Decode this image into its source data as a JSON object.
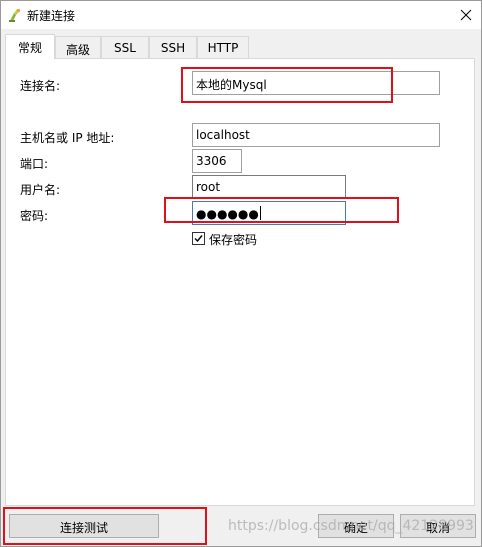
{
  "window": {
    "title": "新建连接",
    "app_icon": "navicat-connection-icon",
    "close_symbol": "✕"
  },
  "tabs": [
    {
      "label": "常规",
      "active": true
    },
    {
      "label": "高级",
      "active": false
    },
    {
      "label": "SSL",
      "active": false
    },
    {
      "label": "SSH",
      "active": false
    },
    {
      "label": "HTTP",
      "active": false
    }
  ],
  "form": {
    "connection_name": {
      "label": "连接名:",
      "value": "本地的Mysql"
    },
    "host": {
      "label": "主机名或 IP 地址:",
      "value": "localhost"
    },
    "port": {
      "label": "端口:",
      "value": "3306"
    },
    "username": {
      "label": "用户名:",
      "value": "root"
    },
    "password": {
      "label": "密码:",
      "value": "●●●●●●"
    },
    "save_password": {
      "label": "保存密码",
      "checked": true,
      "check_symbol": "✓"
    }
  },
  "buttons": {
    "test_connection": "连接测试",
    "ok": "确定",
    "cancel": "取消"
  },
  "watermark": "https://blog.csdn.net/qq_42128993",
  "colors": {
    "annotation_red": "#e0101a",
    "focus_blue": "#3c7fb1",
    "window_bg": "#f0f0f0"
  }
}
